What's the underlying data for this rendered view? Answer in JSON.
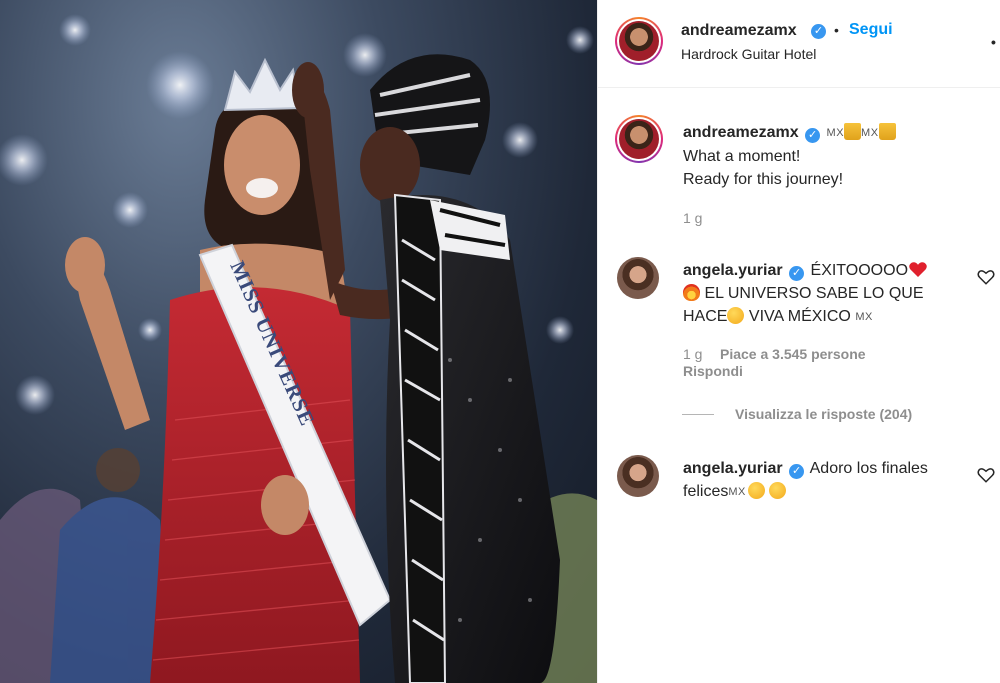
{
  "post": {
    "author": "andreamezamx",
    "follow_label": "Segui",
    "separator": "•",
    "location": "Hardrock Guitar Hotel",
    "more_label": "•",
    "caption": {
      "flag_1": "MX",
      "flag_2": "MX",
      "line_1": "What a moment!",
      "line_2": "Ready for this journey!"
    },
    "time": "1 g",
    "photo_sash_text": "MISS UNIVERSE"
  },
  "comments": [
    {
      "username": "angela.yuriar",
      "text_1": "ÉXITOOOOO",
      "text_2": "EL UNIVERSO SABE LO QUE",
      "text_3": "HACE",
      "text_4": "VIVA MÉXICO",
      "flag": "MX",
      "time": "1 g",
      "likes": "Piace a 3.545 persone",
      "reply_label": "Rispondi",
      "view_replies": "Visualizza le risposte (204)"
    },
    {
      "username": "angela.yuriar",
      "text_1": "Adoro los finales",
      "text_2": "felices",
      "flag": "MX"
    }
  ],
  "colors": {
    "accent": "#0095f6",
    "verified": "#3897f0",
    "muted": "#8e8e8e",
    "dress_red": "#b3202b"
  },
  "icons": [
    "verified-badge-icon",
    "heart-icon",
    "crown-emoji",
    "red-heart-emoji",
    "fire-emoji",
    "heart-eyes-emoji",
    "kissing-face-emoji",
    "zany-face-emoji"
  ]
}
